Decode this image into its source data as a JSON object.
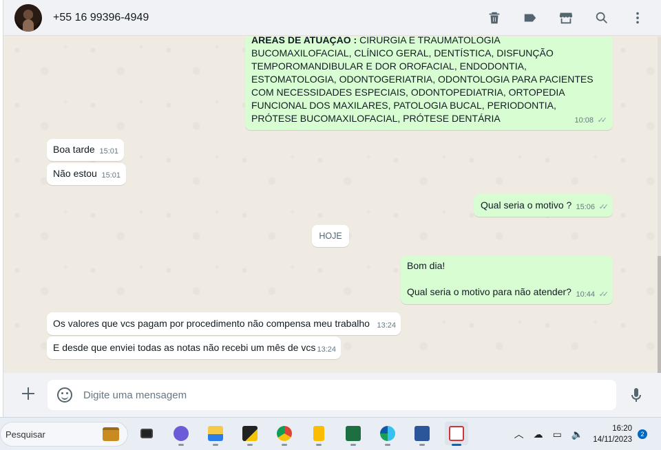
{
  "header": {
    "contact_name": "+55 16 99396-4949",
    "icons": [
      "delete-icon",
      "label-icon",
      "catalog-icon",
      "search-icon",
      "menu-icon"
    ]
  },
  "messages": {
    "m1": {
      "bold": "ÁREAS DE ATUAÇÃO :",
      "text": " CIRURGIA E TRAUMATOLOGIA BUCOMAXILOFACIAL, CLÍNICO GERAL, DENTÍSTICA, DISFUNÇÃO TEMPOROMANDIBULAR E DOR OROFACIAL, ENDODONTIA, ESTOMATOLOGIA, ODONTOGERIATRIA, ODONTOLOGIA PARA PACIENTES COM NECESSIDADES ESPECIAIS, ODONTOPEDIATRIA, ORTOPEDIA FUNCIONAL DOS MAXILARES, PATOLOGIA BUCAL, PERIODONTIA, PRÓTESE BUCOMAXILOFACIAL, PRÓTESE DENTÁRIA",
      "time": "10:08"
    },
    "m2": {
      "text": "Boa tarde",
      "time": "15:01"
    },
    "m3": {
      "text": "Não estou",
      "time": "15:01"
    },
    "m4": {
      "text": "Qual seria o motivo ?",
      "time": "15:06"
    },
    "date_divider": "HOJE",
    "m5": {
      "line1": "Bom dia!",
      "line2": "Qual seria o motivo para não atender?",
      "time": "10:44"
    },
    "m6": {
      "text": "Os valores que vcs pagam por procedimento não compensa meu trabalho",
      "time": "13:24"
    },
    "m7": {
      "text": "E desde que enviei todas as notas não recebi um mês de vcs",
      "time": "13:24"
    },
    "read_ticks": "✓✓"
  },
  "composer": {
    "placeholder": "Digite uma mensagem"
  },
  "taskbar": {
    "search_label": "Pesquisar",
    "apps": [
      "task-view",
      "teams",
      "file-explorer",
      "sticky-notes",
      "chrome",
      "keep",
      "excel",
      "edge",
      "word",
      "snipping-tool"
    ],
    "time": "16:20",
    "date": "14/11/2023",
    "notification_count": "2"
  },
  "colors": {
    "outgoing_bubble": "#d9fdd3",
    "incoming_bubble": "#ffffff",
    "chat_background": "#efeae2",
    "header_background": "#f0f2f5"
  }
}
